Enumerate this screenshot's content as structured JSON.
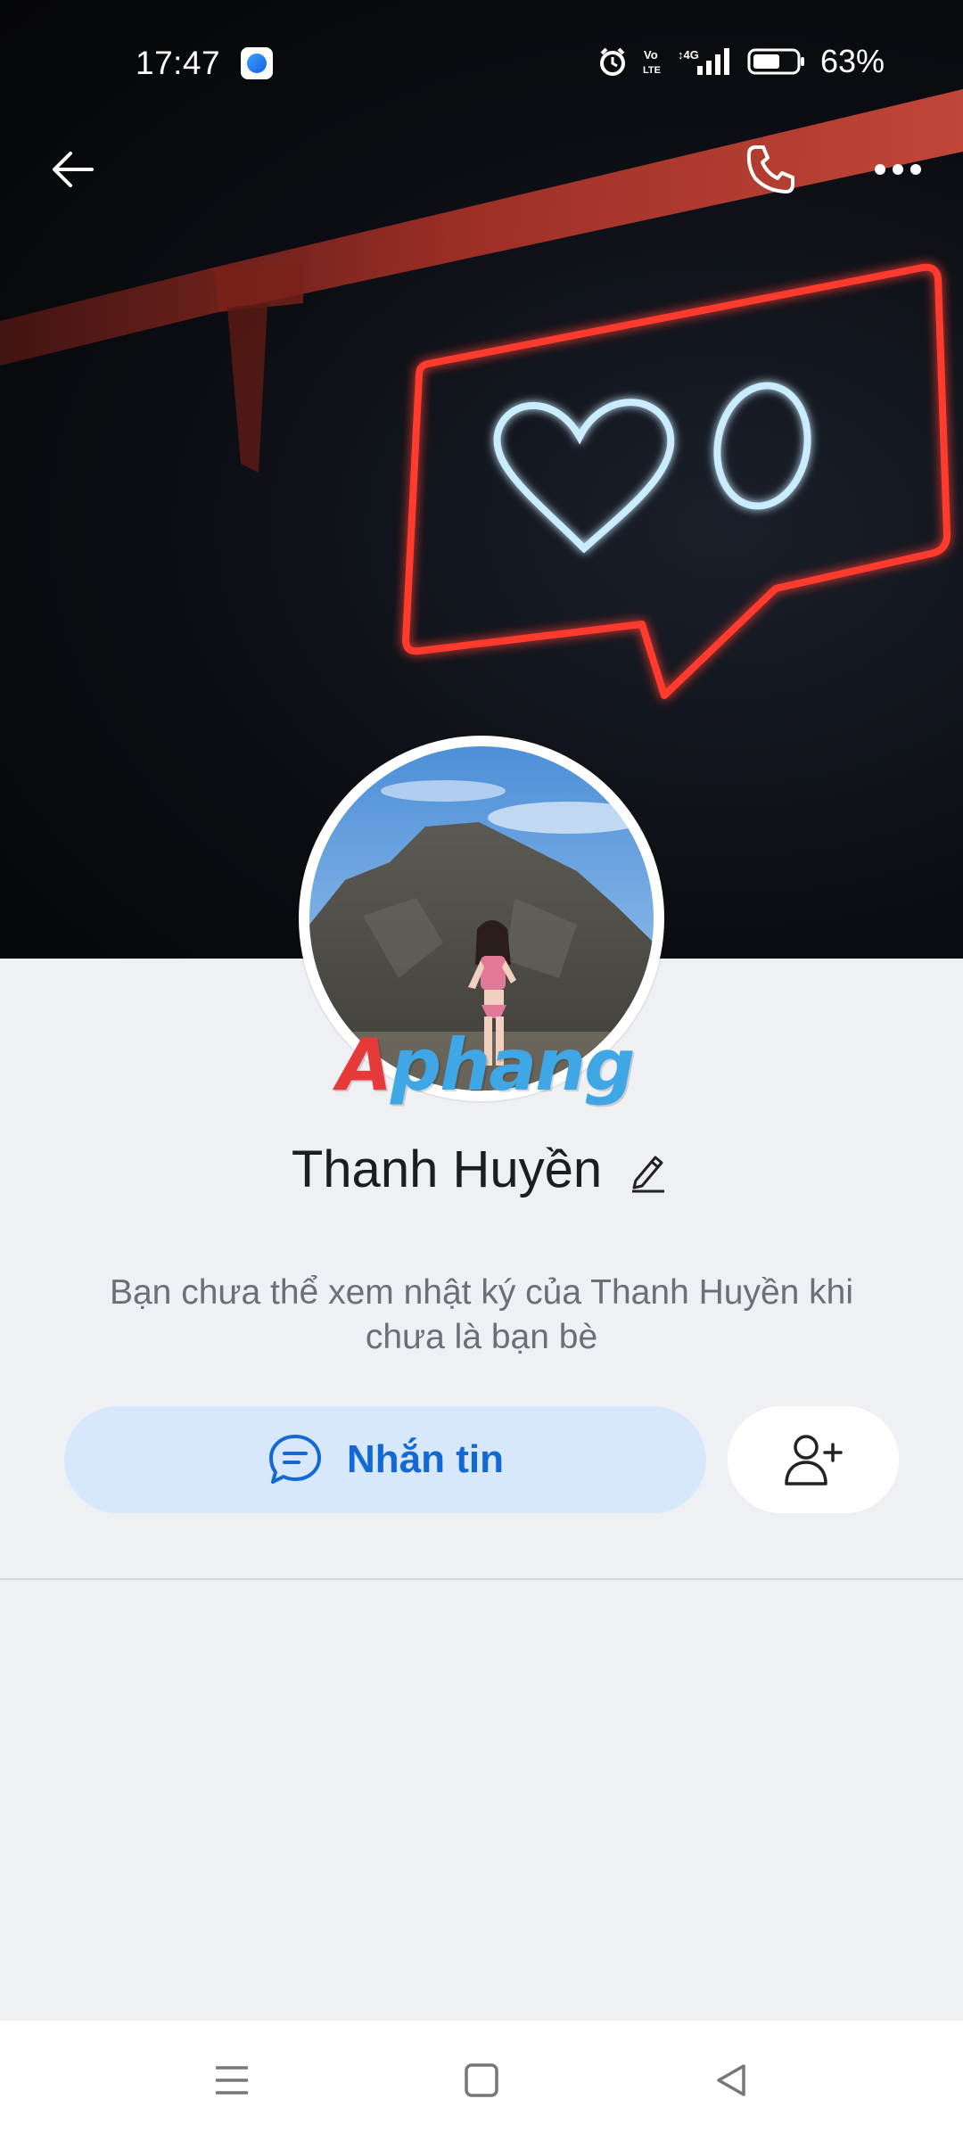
{
  "status_bar": {
    "time": "17:47",
    "battery_percent": "63%",
    "indicators": [
      "alarm-icon",
      "volte-icon",
      "4g-signal-icon",
      "battery-icon"
    ],
    "battery_level": 0.63
  },
  "top_bar": {
    "icons": [
      "back-arrow-icon",
      "phone-icon",
      "more-horizontal-icon"
    ]
  },
  "cover": {
    "description_icons": [
      "neon-heart",
      "neon-zero"
    ]
  },
  "profile": {
    "name": "Thanh Huyền",
    "edit_icon": "pencil-icon",
    "privacy_note": "Bạn chưa thể xem nhật ký của Thanh Huyền khi chưa là bạn bè"
  },
  "watermark": {
    "text_first": "A",
    "text_rest": "phang"
  },
  "actions": {
    "message_label": "Nhắn tin",
    "message_icon": "chat-bubble-icon",
    "add_friend_icon": "add-user-icon"
  },
  "nav_bar": {
    "icons": [
      "menu-icon",
      "home-square-icon",
      "back-triangle-icon"
    ]
  },
  "colors": {
    "accent": "#1368d4",
    "message_button_bg": "#d7e8fc",
    "page_bg": "#eef0f4",
    "neon_red": "#ff3b2f",
    "neon_blue": "#bfe6ff"
  }
}
